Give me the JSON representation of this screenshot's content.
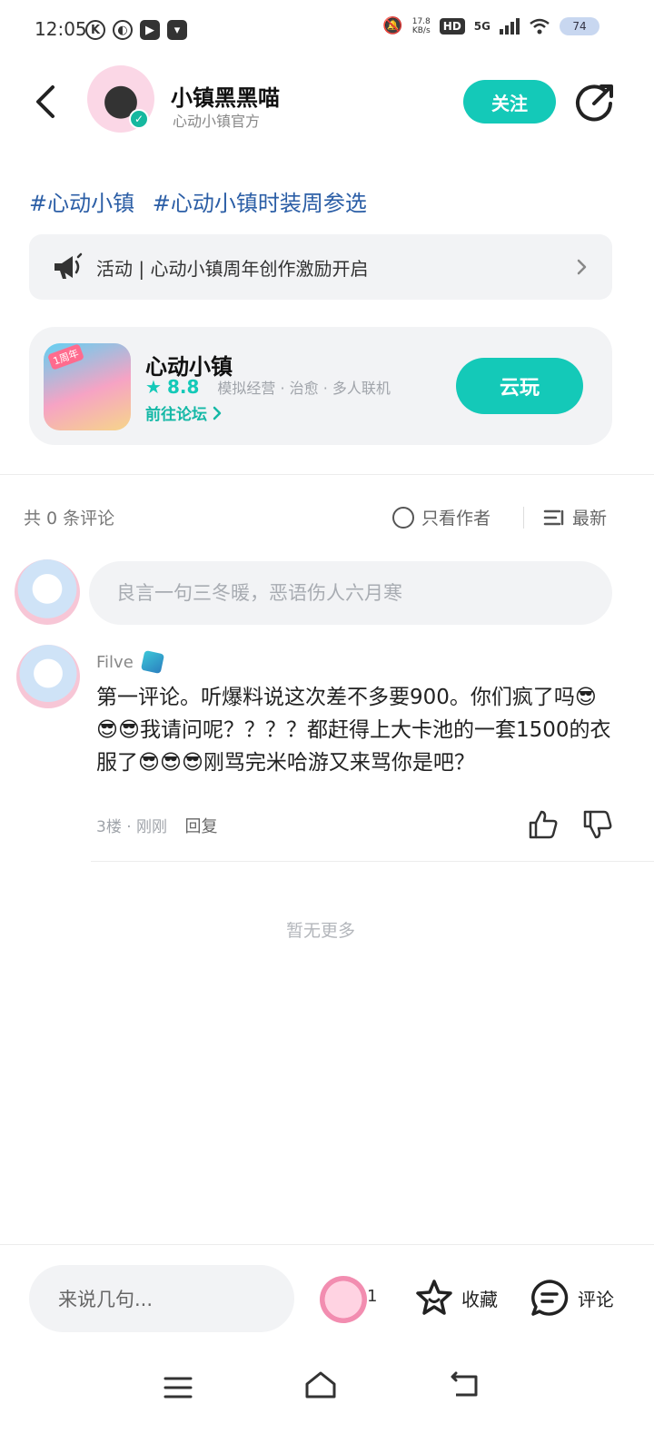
{
  "status_bar": {
    "time": "12:05",
    "net_speed_value": "17.8",
    "net_speed_unit": "KB/s",
    "hd": "HD",
    "network": "5G",
    "battery": "74"
  },
  "header": {
    "account_name": "小镇黑黑喵",
    "account_subtitle": "心动小镇官方",
    "follow_label": "关注"
  },
  "post": {
    "hashtags": [
      "#心动小镇",
      "#心动小镇时装周参选"
    ]
  },
  "activity": {
    "text": "活动 | 心动小镇周年创作激励开启"
  },
  "game_card": {
    "name": "心动小镇",
    "icon_tag": "1周年",
    "rating": "8.8",
    "tags": "模拟经营 · 治愈 · 多人联机",
    "forum_link": "前往论坛",
    "cloud_play_label": "云玩"
  },
  "comments_meta": {
    "count_text": "共 0 条评论",
    "author_only": "只看作者",
    "sort": "最新"
  },
  "comment_input": {
    "placeholder": "良言一句三冬暖，恶语伤人六月寒"
  },
  "comments": [
    {
      "user": "Filve",
      "text": "第一评论。听爆料说这次差不多要900。你们疯了吗😎😎😎我请问呢？？？？都赶得上大卡池的一套1500的衣服了😎😎😎刚骂完米哈游又来骂你是吧？",
      "floor": "3楼",
      "time": "刚刚",
      "reply_label": "回复"
    }
  ],
  "no_more_text": "暂无更多",
  "bottom_bar": {
    "say_placeholder": "来说几句...",
    "sticker_count": "1",
    "favorite_label": "收藏",
    "comment_label": "评论"
  },
  "colors": {
    "accent": "#14c9b8",
    "hashtag": "#2b5ea6",
    "card_bg": "#f2f3f5"
  }
}
